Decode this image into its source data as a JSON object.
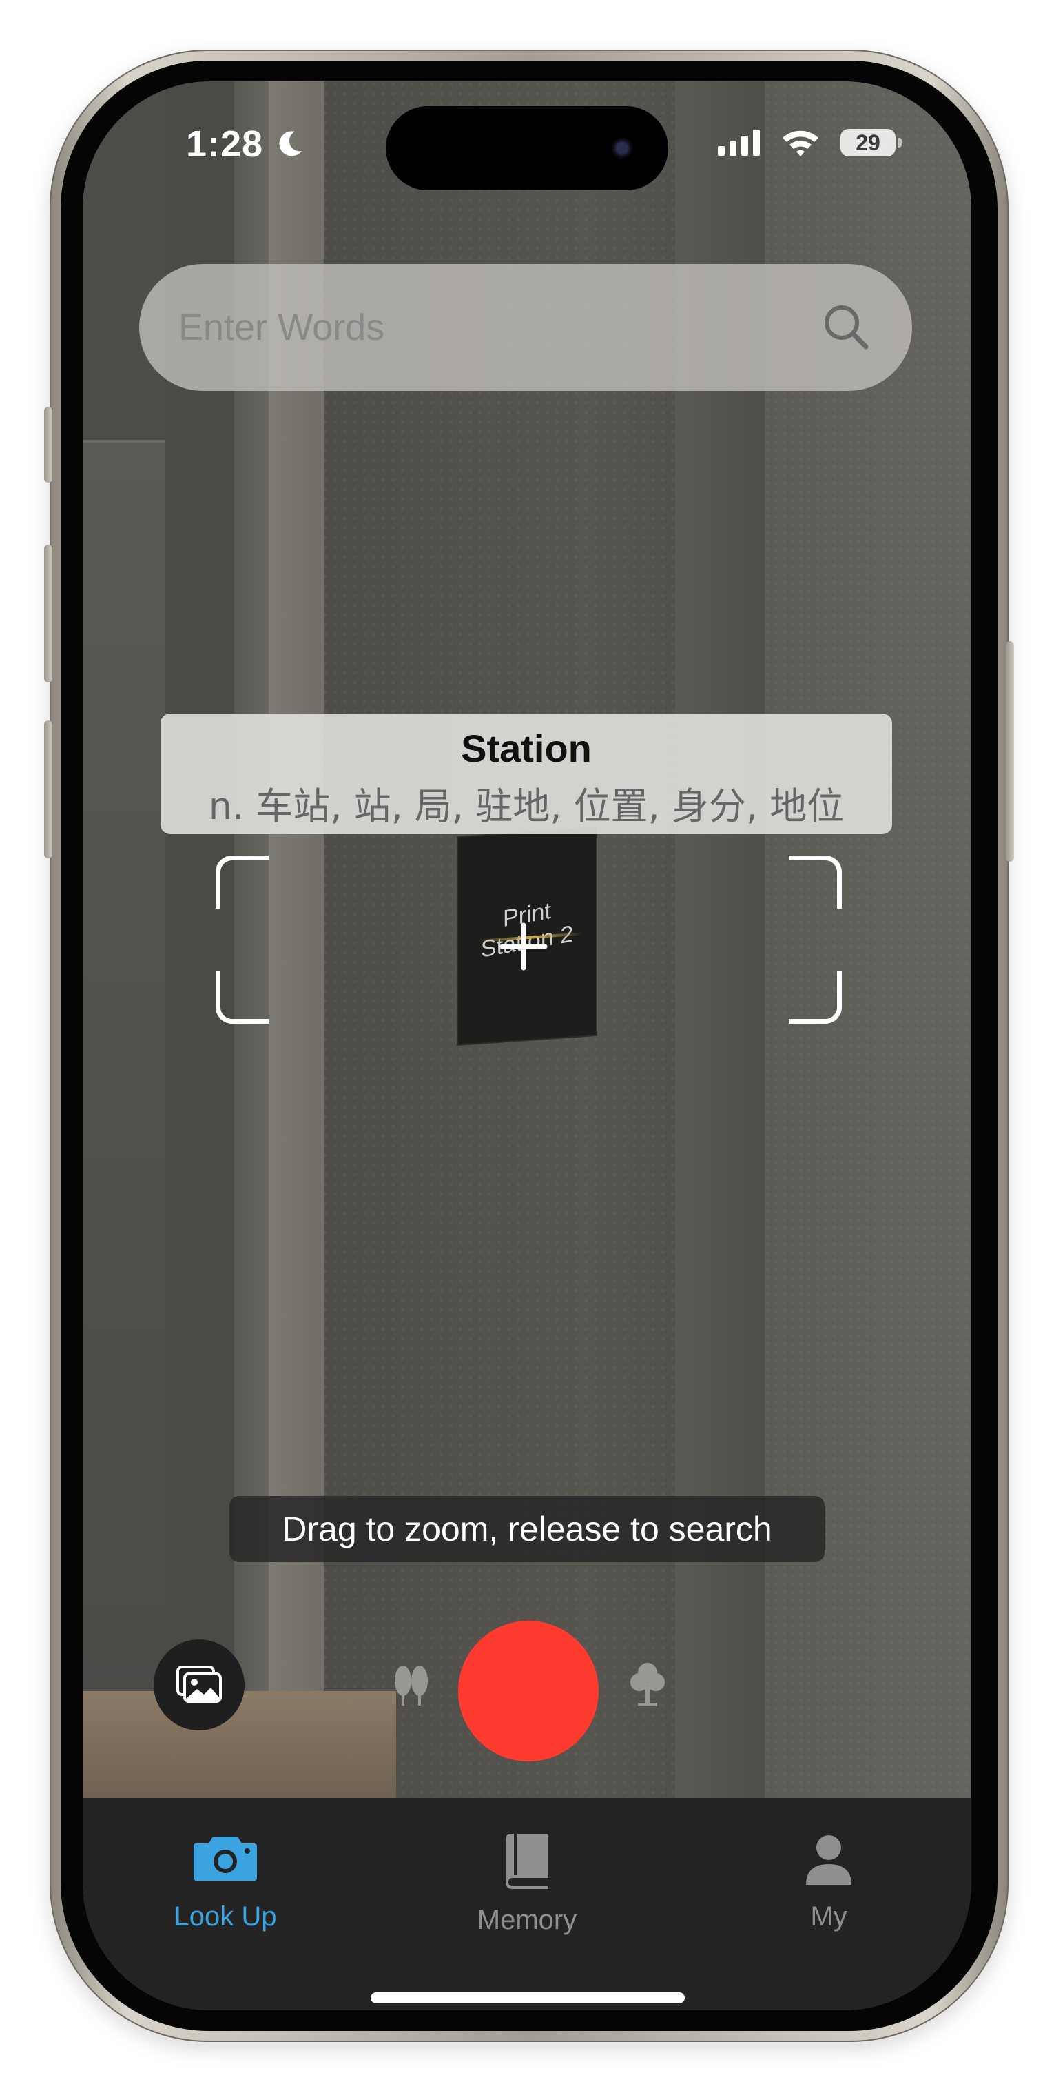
{
  "status_bar": {
    "time": "1:28",
    "battery": "29"
  },
  "search": {
    "placeholder": "Enter Words"
  },
  "translation": {
    "word": "Station",
    "definition": "n. 车站, 站, 局, 驻地, 位置, 身分, 地位"
  },
  "camera_scene": {
    "sign_text": "Print Station 2"
  },
  "hint": "Drag to zoom, release to search",
  "colors": {
    "accent": "#3aa3e0",
    "record": "#ff3b2f",
    "tab_inactive": "#8f8f8f",
    "tabbar_bg": "#232323"
  },
  "tabs": [
    {
      "label": "Look Up",
      "icon": "camera-icon",
      "active": true
    },
    {
      "label": "Memory",
      "icon": "book-icon",
      "active": false
    },
    {
      "label": "My",
      "icon": "person-icon",
      "active": false
    }
  ]
}
